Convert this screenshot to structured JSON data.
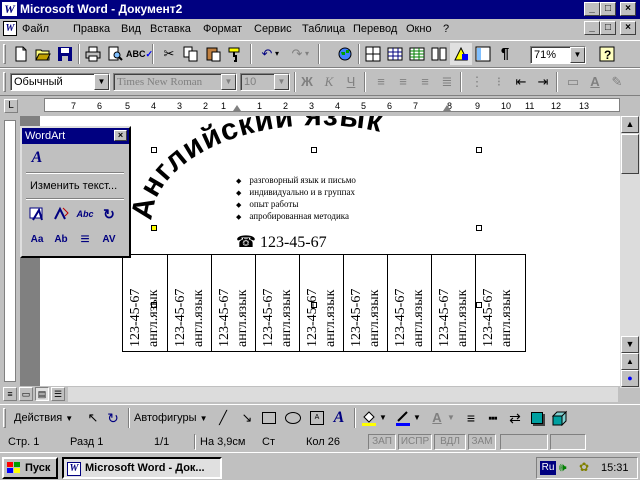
{
  "window": {
    "title": "Microsoft Word - Документ2",
    "app_logo": "W",
    "min_glyph": "_",
    "max_glyph": "□",
    "close_glyph": "×"
  },
  "menu": {
    "items": [
      "Файл",
      "Правка",
      "Вид",
      "Вставка",
      "Формат",
      "Сервис",
      "Таблица",
      "Перевод",
      "Окно",
      "?"
    ],
    "doc_icon": "W",
    "restore_glyph": "□"
  },
  "standard_toolbar": {
    "icons": [
      "new-document-icon",
      "open-folder-icon",
      "save-disk-icon",
      "print-icon",
      "print-preview-icon",
      "spelling-icon",
      "cut-scissors-icon",
      "copy-icon",
      "paste-icon",
      "format-painter-icon",
      "undo-icon",
      "redo-icon",
      "web-hyperlink-icon",
      "tables-borders-icon",
      "insert-table-icon",
      "insert-excel-icon",
      "columns-icon",
      "drawing-icon",
      "document-map-icon",
      "show-formatting-icon",
      "zoom-dropdown",
      "help-icon"
    ],
    "zoom": "71%",
    "pilcrow": "¶"
  },
  "format_toolbar": {
    "style": "Обычный",
    "font": "Times New Roman",
    "size": "10",
    "bold": "Ж",
    "italic": "К",
    "underline": "Ч"
  },
  "ruler": {
    "numbers": [
      "7",
      "6",
      "5",
      "4",
      "3",
      "2",
      "1",
      "1",
      "2",
      "3",
      "4",
      "5",
      "6",
      "7",
      "8",
      "9",
      "10",
      "11",
      "12",
      "13"
    ]
  },
  "wordart_toolbar": {
    "title": "WordArt",
    "close_glyph": "×",
    "edit_text": "Изменить текст...",
    "row1": [
      "Aa",
      "Ab",
      "≡",
      "AV"
    ]
  },
  "document": {
    "wordart_text": "Английский язык",
    "bullets": [
      "разговорный язык и письмо",
      "индивидуально и в группах",
      "опыт работы",
      "апробированная методика"
    ],
    "phone_icon": "☎",
    "phone": "123-45-67",
    "tear_strips": [
      {
        "phone": "123-45-67",
        "label": "англ.язык"
      },
      {
        "phone": "123-45-67",
        "label": "англ.язык"
      },
      {
        "phone": "123-45-67",
        "label": "англ.язык"
      },
      {
        "phone": "123-45-67",
        "label": "англ.язык"
      },
      {
        "phone": "123-45-67",
        "label": "англ.язык"
      },
      {
        "phone": "123-45-67",
        "label": "англ.язык"
      },
      {
        "phone": "123-45-67",
        "label": "англ.язык"
      },
      {
        "phone": "123-45-67",
        "label": "англ.язык"
      },
      {
        "phone": "123-45-67",
        "label": "англ.язык"
      }
    ]
  },
  "drawing_toolbar": {
    "actions": "Действия",
    "autoshapes": "Автофигуры"
  },
  "status": {
    "page": "Стр. 1",
    "section": "Разд 1",
    "pages": "1/1",
    "position": "На 3,9см",
    "line": "Ст",
    "column": "Кол 26",
    "rec": "ЗАП",
    "trk": "ИСПР",
    "ext": "ВДЛ",
    "ovr": "ЗАМ"
  },
  "taskbar": {
    "start": "Пуск",
    "task": "Microsoft Word - Док...",
    "lang": "Ru",
    "time": "15:31"
  }
}
